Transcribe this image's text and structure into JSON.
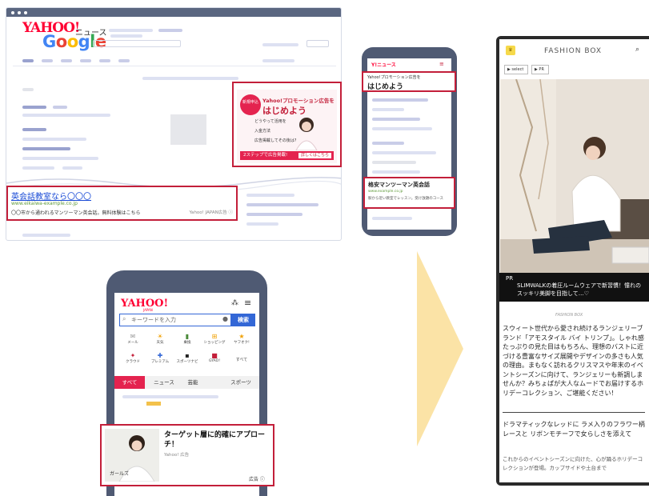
{
  "browser": {
    "yahoo_logo": "YAHOO!",
    "yahoo_sub": "ニュース",
    "google_logo": {
      "G": "G",
      "o1": "o",
      "o2": "o",
      "g": "g",
      "l": "l",
      "e": "e"
    },
    "display_ad": {
      "badge": "新規申込",
      "title_small": "Yahoo!プロモーション広告を",
      "title_big": "はじめよう",
      "line1": "どうやって活用を",
      "line2": "入金方法",
      "line3": "広告掲載してその後は?",
      "cta": "2ステップで広告掲載!",
      "cta_button": "詳しくはこちら"
    },
    "search_ad": {
      "title": "英会話教室なら〇〇〇",
      "url": "www.eikaiwa-example.co.jp",
      "desc": "〇〇市から通われるマンツーマン英会話。無料体験はこちら",
      "meta": "Yahoo! JAPAN広告 ⓘ"
    }
  },
  "phone1": {
    "header": "Y!ニュース",
    "ad_small": "Yahoo!プロモーション広告を",
    "ad_big": "はじめよう",
    "listing_title": "格安マンツーマン英会話",
    "listing_url": "www.example.co.jp",
    "listing_desc": "駅から近い教室でレッスン。受け放題のコース"
  },
  "phone2": {
    "logo": "YAHOO!",
    "logo_sub": "JAPAN",
    "search_placeholder": "キーワードを入力",
    "search_button": "検索",
    "icons_row1": [
      "メール",
      "天気",
      "乗換",
      "ショッピング",
      "ヤフオク!"
    ],
    "icons_row2": [
      "クラウド",
      "プレミアム",
      "スポーツナビ",
      "GYAO!",
      "すべて"
    ],
    "tabs": [
      "すべて",
      "ニュース",
      "芸能",
      "スポーツ"
    ],
    "ad_title": "ターゲット層に的確にアプローチ！",
    "ad_source": "Yahoo! 広告",
    "ad_label": "広告 ⓘ"
  },
  "phone3": {
    "brand": "FASHION BOX",
    "chips": [
      "▶ select",
      "▶ PR"
    ],
    "pr_label": "PR",
    "caption": "SLIMWALKの着圧ルームウェアで新習慣！憧れのスッキリ美脚を目指して…♡",
    "tagline": "FASHION BOX",
    "paragraph1": "スウィート世代から愛され続けるランジェリーブランド「アモスタイル バイ トリンプ」。しゃれ感たっぷりの見た目はもちろん、理想のバストに近づける豊富なサイズ展開やデザインの多さも人気の理由。まもなく訪れるクリスマスや年末のイベントシーズンに向けて、ランジェリーも新調しませんか？みちょぱが大人なムードでお届けするホリデーコレクション、ご堪能ください！",
    "heading": "ドラマティックなレッドに ラメ入りのフラワー柄レースと リボンモチーフで女らしさを添えて",
    "paragraph2": "これからのイベントシーズンに向けた、心が踊るホリデーコレクションが登場。カップサイドや土台まで"
  },
  "colors": {
    "accent_red": "#c31f3a",
    "phone_frame": "#4f5a73",
    "arrow": "#fbe3a6"
  }
}
